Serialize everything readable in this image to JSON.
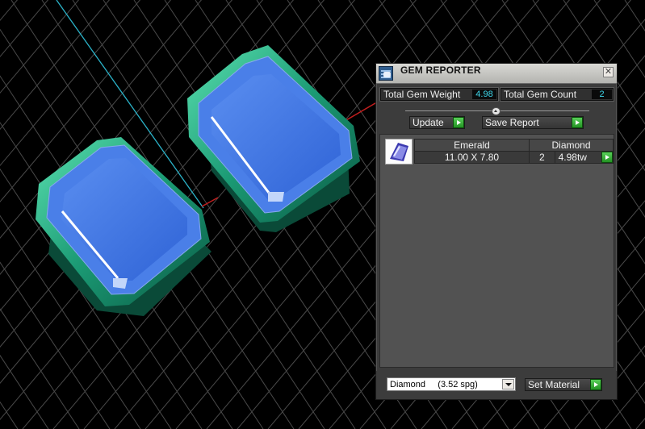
{
  "panel": {
    "title": "GEM REPORTER",
    "close_glyph": "✕",
    "total_weight_label": "Total Gem Weight",
    "total_weight_value": "4.98",
    "total_count_label": "Total Gem Count",
    "total_count_value": "2",
    "update_label": "Update",
    "save_report_label": "Save Report",
    "gem_row": {
      "shape": "Emerald",
      "size": "11.00 X 7.80",
      "material": "Diamond",
      "count": "2",
      "weight": "4.98tw"
    },
    "material_select": "Diamond     (3.52 spg)",
    "set_material_label": "Set Material"
  },
  "icons": {
    "app": "gem-reporter-icon",
    "close": "close-icon",
    "gem": "gem-thumbnail",
    "go": "green-arrow-icon"
  },
  "colors": {
    "gem_face": "#3a6fe3",
    "gem_setting": "#1fa27a",
    "axis_red": "#c21e1e",
    "axis_cyan": "#2bb3c9",
    "value_text": "#3fd8ec",
    "go_green": "#2fb22f"
  }
}
